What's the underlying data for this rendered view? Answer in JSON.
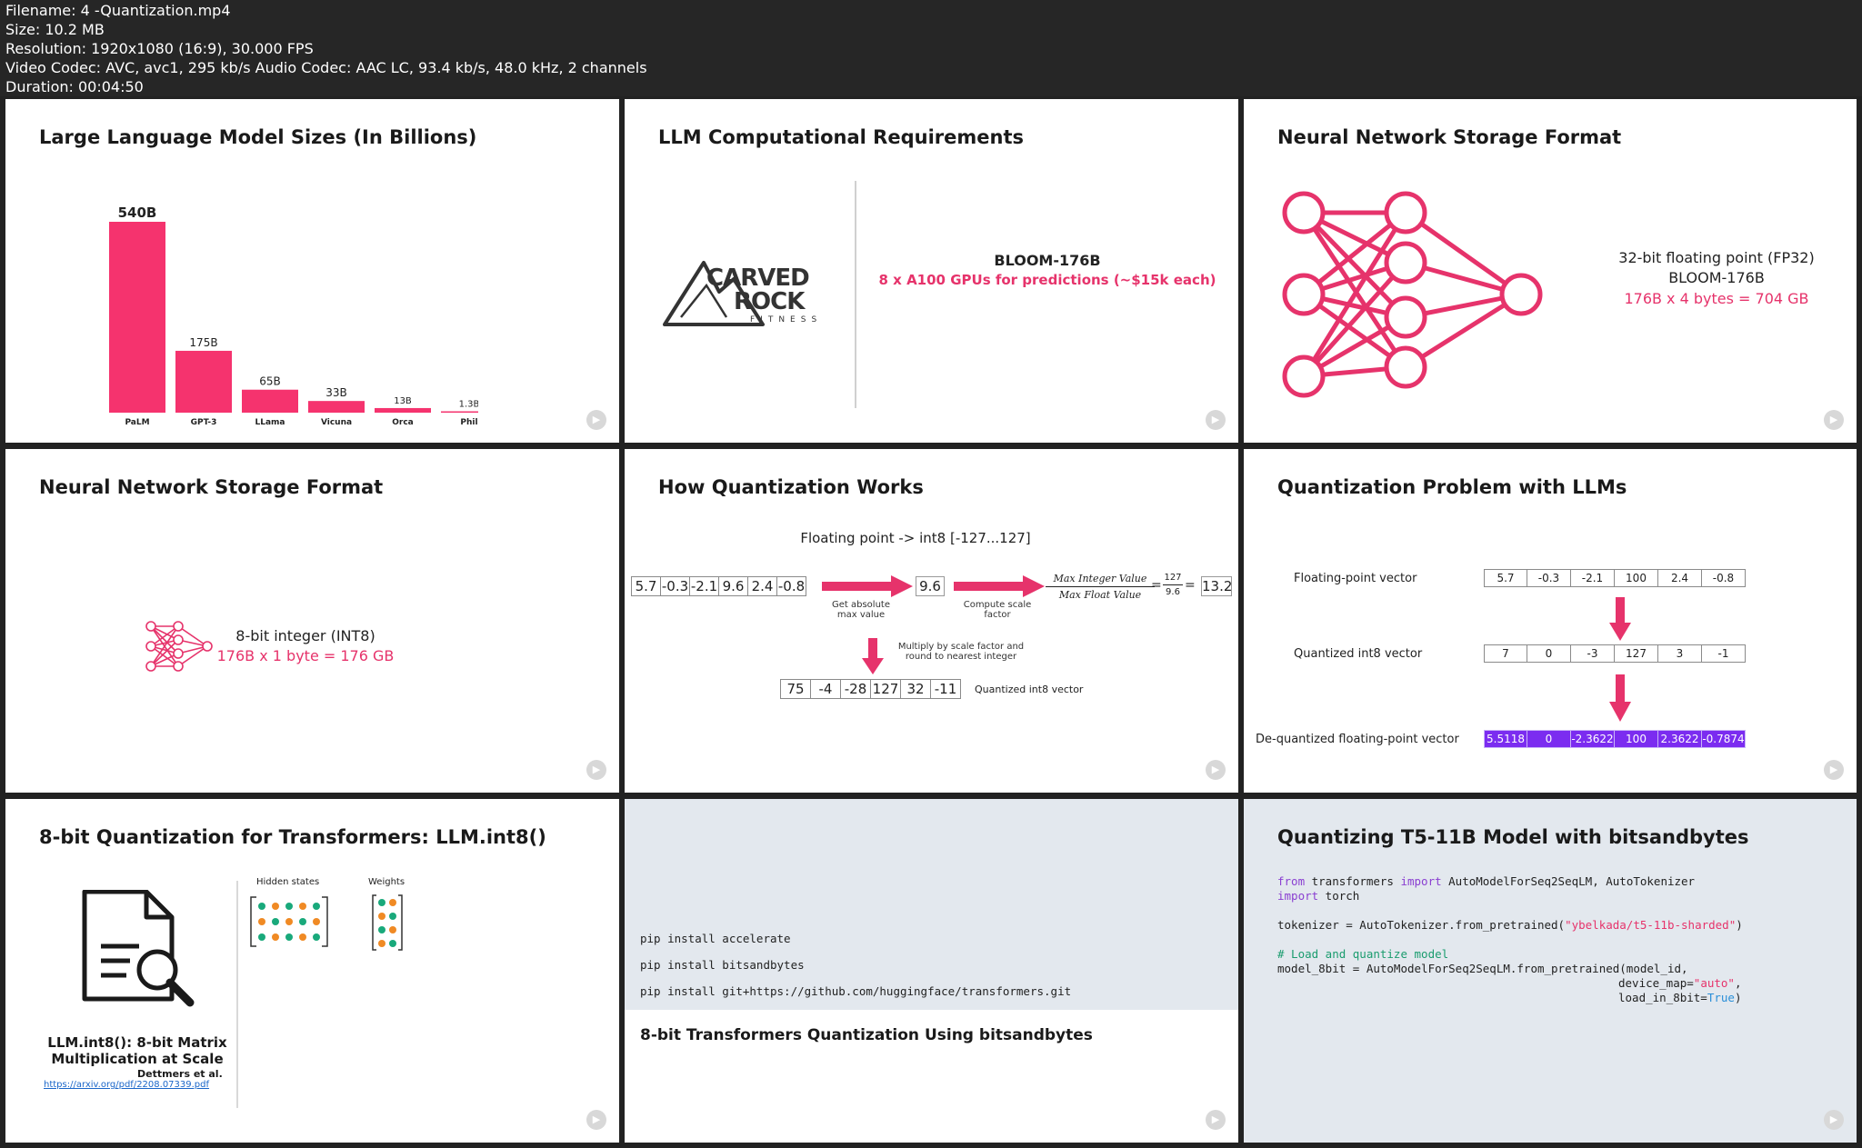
{
  "header": {
    "filename": "Filename: 4 -Quantization.mp4",
    "size": "Size: 10.2 MB",
    "resolution": "Resolution: 1920x1080 (16:9), 30.000 FPS",
    "codec": "Video Codec: AVC, avc1, 295 kb/s Audio Codec: AAC LC, 93.4 kb/s, 48.0 kHz, 2 channels",
    "duration": "Duration: 00:04:50"
  },
  "slides": {
    "s1": {
      "title": "Large Language Model Sizes (In Billions)",
      "chart_data": {
        "type": "bar",
        "categories": [
          "PaLM",
          "GPT-3",
          "LLama",
          "Vicuna",
          "Orca",
          "Phil"
        ],
        "values": [
          540,
          175,
          65,
          33,
          13,
          1.3
        ],
        "labels": [
          "540B",
          "175B",
          "65B",
          "33B",
          "13B",
          "1.3B"
        ],
        "color": "#f5336e"
      }
    },
    "s2": {
      "title": "LLM Computational Requirements",
      "logo_top": "CARVED",
      "logo_mid": "ROCK",
      "logo_sub": "FITNESS",
      "model": "BLOOM-176B",
      "gpus": "8 x A100 GPUs for predictions (~$15k each)"
    },
    "s3": {
      "title": "Neural Network Storage Format",
      "line1": "32-bit floating point (FP32)",
      "line2": "BLOOM-176B",
      "line3": "176B x 4 bytes = 704 GB"
    },
    "s4": {
      "title": "Neural Network Storage Format",
      "line1": "8-bit integer (INT8)",
      "line2": "176B x 1 byte = 176 GB"
    },
    "s5": {
      "title": "How Quantization Works",
      "subtitle": "Floating point -> int8 [-127...127]",
      "input": [
        "5.7",
        "-0.3",
        "-2.1",
        "9.6",
        "2.4",
        "-0.8"
      ],
      "step1": "Get absolute max value",
      "maxval": "9.6",
      "step2": "Compute scale factor",
      "formula_num": "Max Integer Value",
      "formula_den": "Max Float Value",
      "eq": "=",
      "frac_num": "127",
      "frac_den": "9.6",
      "scale": "13.2",
      "step3": "Multiply by scale factor and round to nearest integer",
      "output": [
        "75",
        "-4",
        "-28",
        "127",
        "32",
        "-11"
      ],
      "output_label": "Quantized int8 vector"
    },
    "s6": {
      "title": "Quantization Problem with LLMs",
      "row1_label": "Floating-point vector",
      "row1": [
        "5.7",
        "-0.3",
        "-2.1",
        "100",
        "2.4",
        "-0.8"
      ],
      "row2_label": "Quantized int8 vector",
      "row2": [
        "7",
        "0",
        "-3",
        "127",
        "3",
        "-1"
      ],
      "row3_label": "De-quantized floating-point vector",
      "row3": [
        "5.5118",
        "0",
        "-2.3622",
        "100",
        "2.3622",
        "-0.7874"
      ],
      "row3_color": "#7b2cf0"
    },
    "s7": {
      "title": "8-bit Quantization for Transformers: LLM.int8()",
      "hidden": "Hidden states",
      "weights": "Weights",
      "paper_title1": "LLM.int8(): 8-bit Matrix",
      "paper_title2": "Multiplication at Scale",
      "authors": "Dettmers et al.",
      "link": "https://arxiv.org/pdf/2208.07339.pdf"
    },
    "s8": {
      "cmd1": "pip install accelerate",
      "cmd2": "pip install bitsandbytes",
      "cmd3": "pip install git+https://github.com/huggingface/transformers.git",
      "caption": "8-bit Transformers Quantization Using bitsandbytes"
    },
    "s9": {
      "title": "Quantizing T5-11B Model with bitsandbytes",
      "c_from": "from",
      "c_transformers": " transformers ",
      "c_import": "import",
      "c_classes": " AutoModelForSeq2SeqLM, AutoTokenizer",
      "c_import2": "import",
      "c_torch": " torch",
      "c_tok1": "tokenizer = AutoTokenizer.from_pretrained(",
      "c_tokstr": "\"ybelkada/t5-11b-sharded\"",
      "c_tok2": ")",
      "c_comment": "# Load and quantize model",
      "c_model": "model_8bit = AutoModelForSeq2SeqLM.from_pretrained(model_id,",
      "c_dm1": "device_map=",
      "c_dmstr": "\"auto\"",
      "c_dm2": ",",
      "c_l1": "load_in_8bit=",
      "c_true": "True",
      "c_l2": ")"
    }
  }
}
